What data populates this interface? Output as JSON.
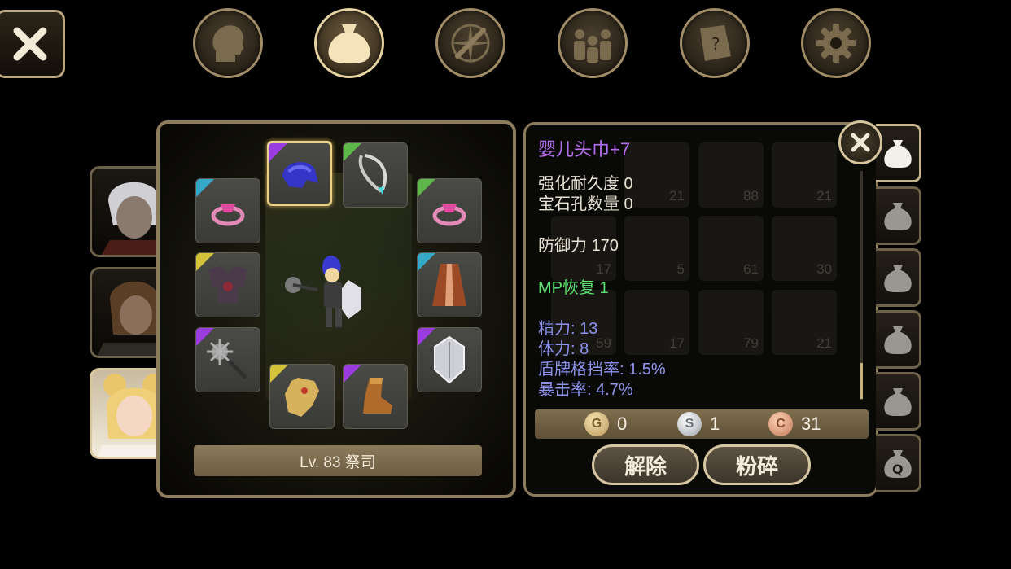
{
  "top_tabs": [
    {
      "id": "character",
      "icon": "head-icon"
    },
    {
      "id": "inventory",
      "icon": "bag-icon",
      "active": true
    },
    {
      "id": "skills",
      "icon": "compass-sword-icon"
    },
    {
      "id": "party",
      "icon": "party-icon"
    },
    {
      "id": "quests",
      "icon": "scroll-question-icon"
    },
    {
      "id": "settings",
      "icon": "gear-icon"
    }
  ],
  "portraits": [
    {
      "id": "white-hair-hero"
    },
    {
      "id": "brown-hair-hero"
    },
    {
      "id": "blonde-priest",
      "active": true
    }
  ],
  "equipment": {
    "level_label": "Lv. 83 祭司",
    "slots": [
      {
        "id": "helmet",
        "icon": "hood-icon",
        "rarity": "purple",
        "selected": true
      },
      {
        "id": "necklace",
        "icon": "necklace-icon",
        "rarity": "green"
      },
      {
        "id": "ring-left",
        "icon": "ring-icon",
        "rarity": "cyan"
      },
      {
        "id": "ring-right",
        "icon": "ring-icon",
        "rarity": "green"
      },
      {
        "id": "armor",
        "icon": "armor-icon",
        "rarity": "yellow"
      },
      {
        "id": "cloak",
        "icon": "cloak-icon",
        "rarity": "cyan"
      },
      {
        "id": "weapon",
        "icon": "mace-icon",
        "rarity": "purple"
      },
      {
        "id": "shield",
        "icon": "shield-icon",
        "rarity": "purple"
      },
      {
        "id": "gloves",
        "icon": "gauntlet-icon",
        "rarity": "yellow"
      },
      {
        "id": "boots",
        "icon": "boot-icon",
        "rarity": "purple"
      }
    ]
  },
  "item_info": {
    "name": "婴儿头巾+7",
    "enhance_durability": "强化耐久度 0",
    "gem_slots": "宝石孔数量 0",
    "defense": "防御力 170",
    "bonus": "MP恢复 1",
    "stats": [
      "精力: 13",
      "体力: 8",
      "盾牌格挡率: 1.5%",
      "暴击率: 4.7%"
    ]
  },
  "background_grid_counts": [
    "21",
    "88",
    "21",
    "17",
    "5",
    "61",
    "30",
    "59",
    "17",
    "79",
    "21"
  ],
  "currency": {
    "gold": "0",
    "silver": "1",
    "copper": "31",
    "gold_symbol": "G",
    "silver_symbol": "S",
    "copper_symbol": "C"
  },
  "actions": {
    "unequip": "解除",
    "smash": "粉碎"
  },
  "bag_tabs": [
    "bag-1",
    "bag-2",
    "bag-3",
    "bag-4",
    "bag-5",
    "bag-6",
    "bag-quest"
  ],
  "bag_quest_label": "Q",
  "colors": {
    "item_name": "#b66ef0",
    "bonus": "#5ee070",
    "stats": "#8e93ef",
    "frame": "#8c7c5c"
  }
}
